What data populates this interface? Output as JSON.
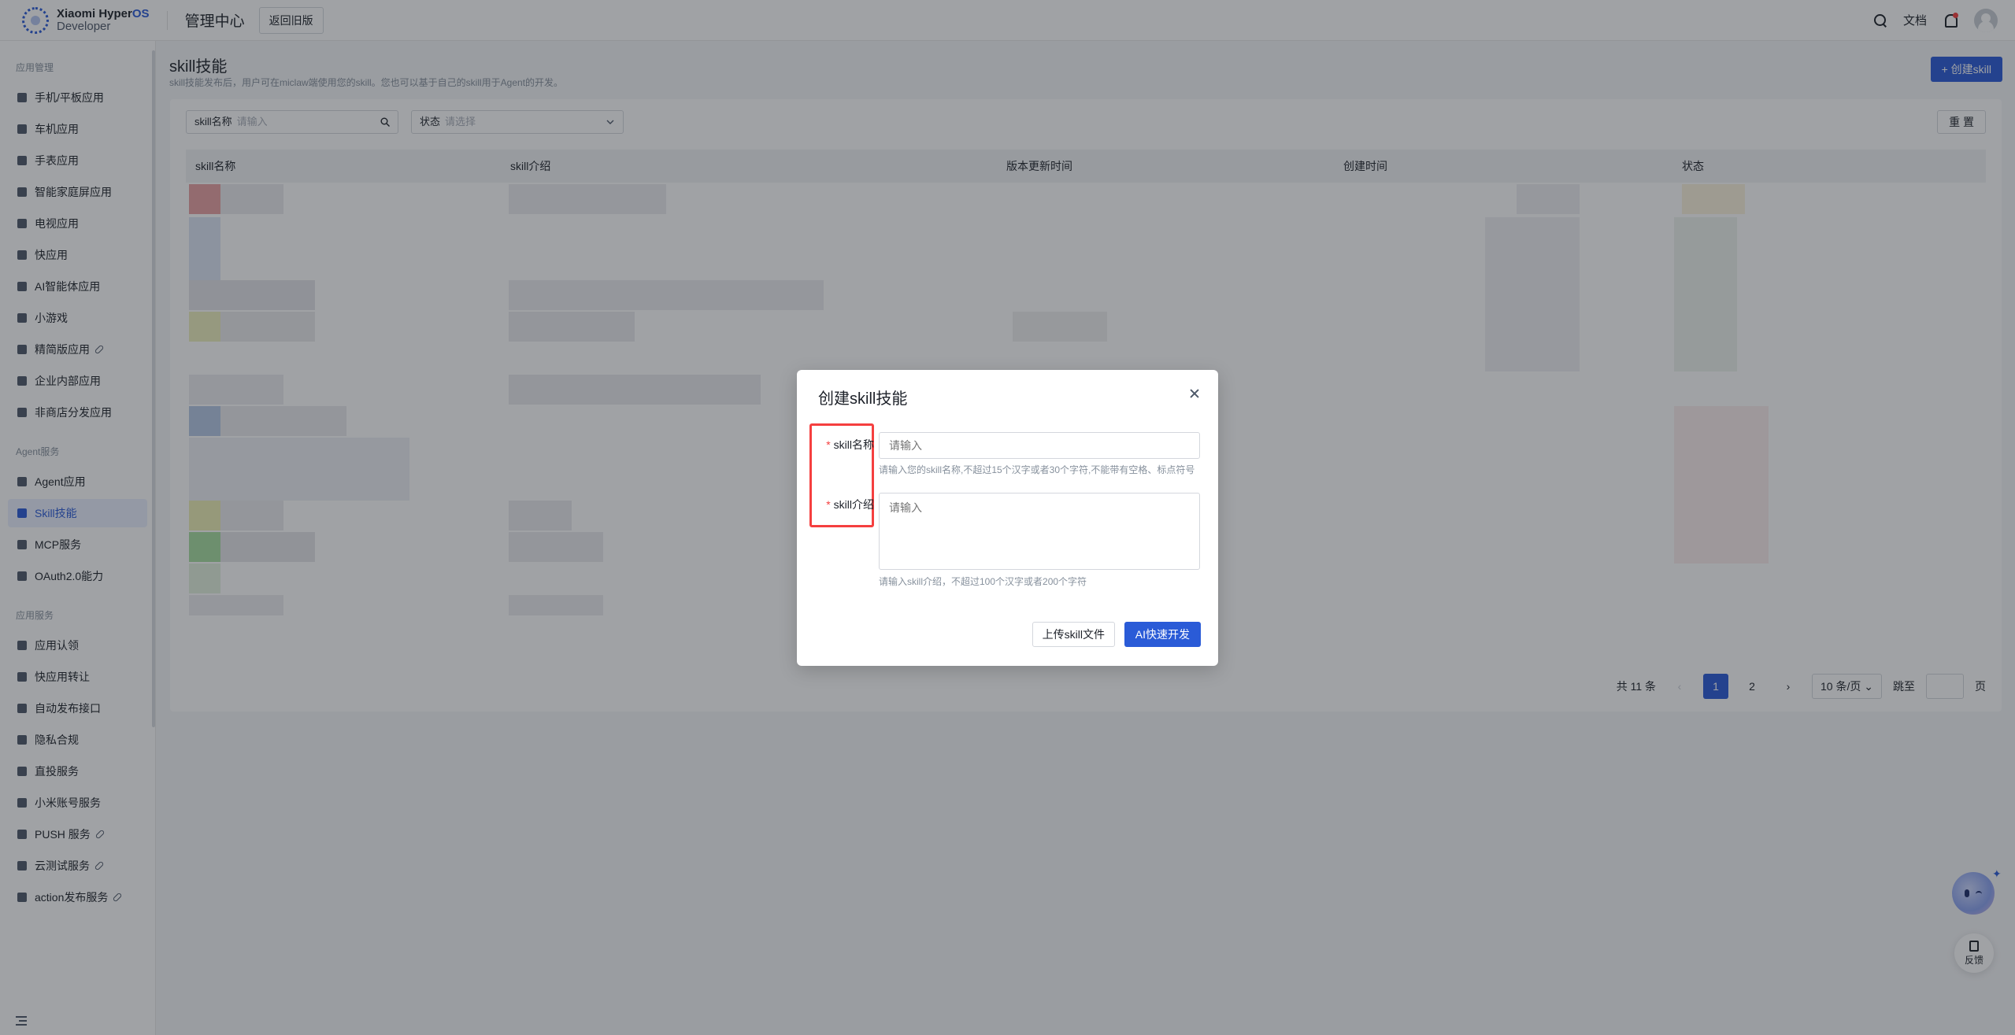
{
  "topbar": {
    "logo_line1": "Xiaomi Hyper",
    "logo_line1_os": "OS",
    "logo_line2": "Developer",
    "app_title": "管理中心",
    "back_old": "返回旧版",
    "docs": "文档"
  },
  "sidebar": {
    "groups": [
      {
        "title": "应用管理",
        "items": [
          "手机/平板应用",
          "车机应用",
          "手表应用",
          "智能家庭屏应用",
          "电视应用",
          "快应用",
          "AI智能体应用",
          "小游戏",
          "精简版应用",
          "企业内部应用",
          "非商店分发应用"
        ]
      },
      {
        "title": "Agent服务",
        "items": [
          "Agent应用",
          "Skill技能",
          "MCP服务",
          "OAuth2.0能力"
        ]
      },
      {
        "title": "应用服务",
        "items": [
          "应用认领",
          "快应用转让",
          "自动发布接口",
          "隐私合规",
          "直投服务",
          "小米账号服务",
          "PUSH 服务",
          "云测试服务",
          "action发布服务"
        ]
      }
    ]
  },
  "page": {
    "title": "skill技能",
    "desc": "skill技能发布后，用户可在miclaw端使用您的skill。您也可以基于自己的skill用于Agent的开发。",
    "create_button": "+ 创建skill"
  },
  "filters": {
    "name_label": "skill名称",
    "name_placeholder": "请输入",
    "status_label": "状态",
    "status_placeholder": "请选择",
    "reset": "重 置"
  },
  "table": {
    "columns": [
      "skill名称",
      "skill介绍",
      "版本更新时间",
      "创建时间",
      "状态"
    ]
  },
  "pagination": {
    "total": "共 11 条",
    "pages": [
      "1",
      "2"
    ],
    "current": "1",
    "page_size": "10 条/页",
    "jump_label": "跳至",
    "page_suffix": "页"
  },
  "modal": {
    "title": "创建skill技能",
    "name_label": "skill名称",
    "name_placeholder": "请输入",
    "name_hint": "请输入您的skill名称,不超过15个汉字或者30个字符,不能带有空格、标点符号",
    "intro_label": "skill介绍",
    "intro_placeholder": "请输入",
    "intro_hint": "请输入skill介绍，不超过100个汉字或者200个字符",
    "upload_button": "上传skill文件",
    "ai_button": "AI快速开发"
  },
  "floating": {
    "feedback": "反馈"
  },
  "colors": {
    "primary": "#2a5bd7",
    "danger": "#f53f3f"
  }
}
